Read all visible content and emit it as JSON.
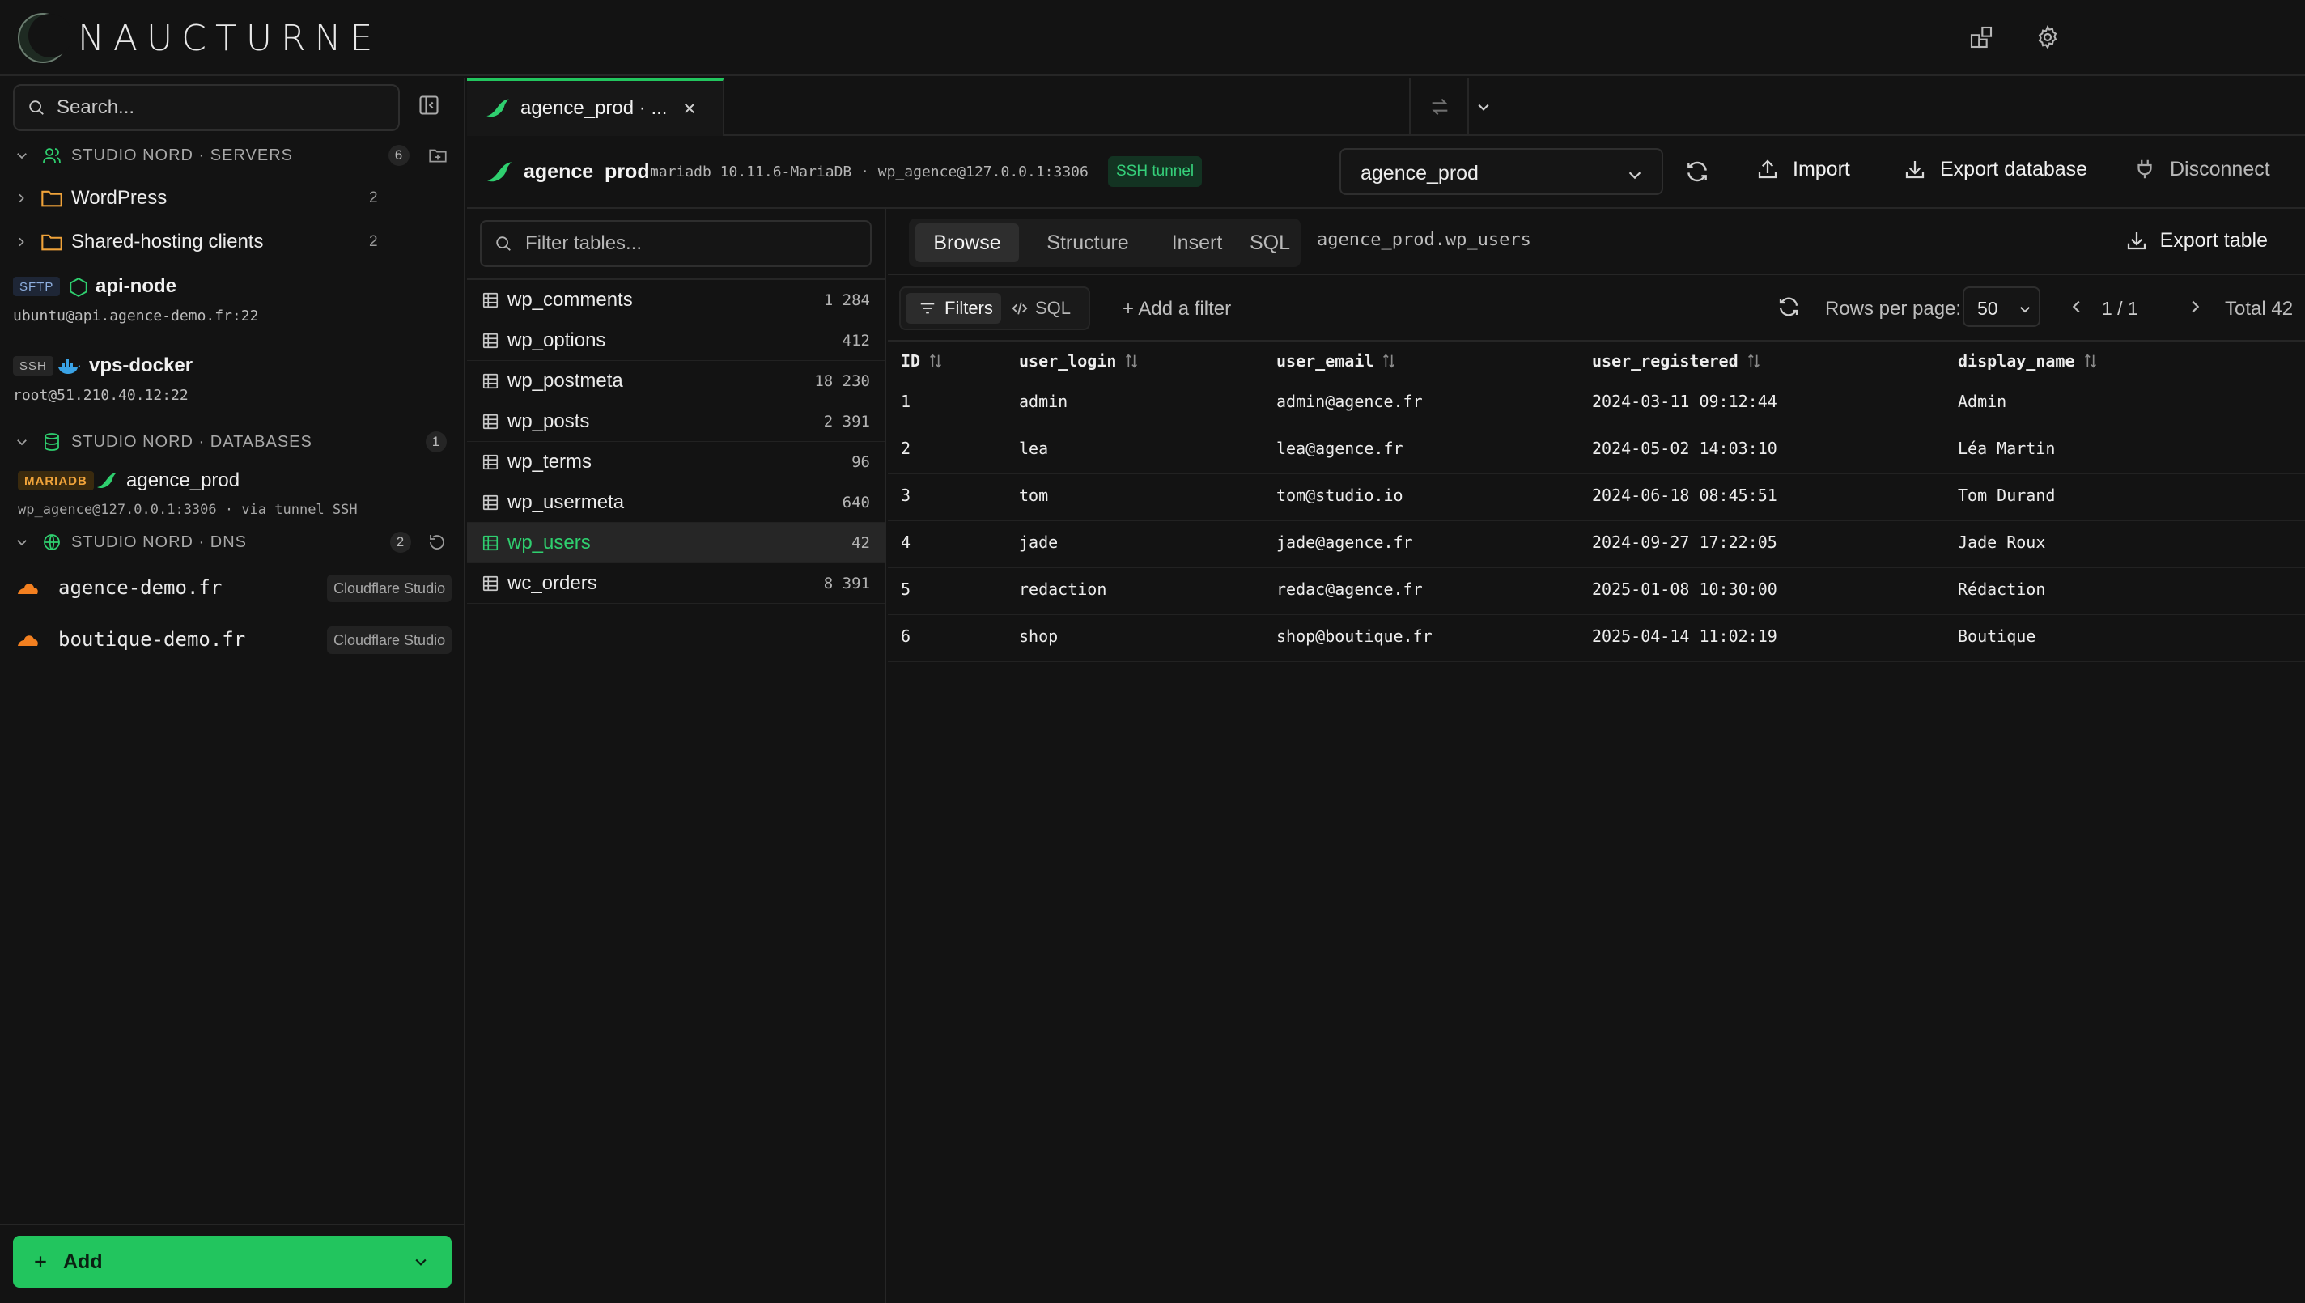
{
  "app": {
    "name": "NAUCTURNE"
  },
  "sidebar": {
    "search_placeholder": "Search...",
    "servers_group": {
      "label": "STUDIO NORD · SERVERS",
      "count": "6"
    },
    "folders": [
      {
        "label": "WordPress",
        "count": "2"
      },
      {
        "label": "Shared-hosting clients",
        "count": "2"
      }
    ],
    "connections": [
      {
        "type": "SFTP",
        "name": "api-node",
        "address": "ubuntu@api.agence-demo.fr:22"
      },
      {
        "type": "SSH",
        "name": "vps-docker",
        "address": "root@51.210.40.12:22"
      }
    ],
    "databases_group": {
      "label": "STUDIO NORD · DATABASES",
      "count": "1"
    },
    "database": {
      "engine": "MARIADB",
      "name": "agence_prod",
      "address": "wp_agence@127.0.0.1:3306 · via tunnel SSH"
    },
    "dns_group": {
      "label": "STUDIO NORD · DNS",
      "count": "2"
    },
    "dns": [
      {
        "domain": "agence-demo.fr",
        "provider": "Cloudflare Studio"
      },
      {
        "domain": "boutique-demo.fr",
        "provider": "Cloudflare Studio"
      }
    ],
    "add_label": "Add"
  },
  "tab": {
    "label": "agence_prod · ..."
  },
  "header": {
    "title": "agence_prod",
    "meta": "mariadb 10.11.6-MariaDB · wp_agence@127.0.0.1:3306",
    "tunnel": "SSH tunnel",
    "db_select": "agence_prod",
    "import": "Import",
    "export_db": "Export database",
    "disconnect": "Disconnect"
  },
  "tables": {
    "filter_placeholder": "Filter tables...",
    "items": [
      {
        "name": "wp_comments",
        "count": "1 284"
      },
      {
        "name": "wp_options",
        "count": "412"
      },
      {
        "name": "wp_postmeta",
        "count": "18 230"
      },
      {
        "name": "wp_posts",
        "count": "2 391"
      },
      {
        "name": "wp_terms",
        "count": "96"
      },
      {
        "name": "wp_usermeta",
        "count": "640"
      },
      {
        "name": "wp_users",
        "count": "42"
      },
      {
        "name": "wc_orders",
        "count": "8 391"
      }
    ],
    "active": "wp_users"
  },
  "main": {
    "tabs": [
      "Browse",
      "Structure",
      "Insert",
      "SQL"
    ],
    "active_tab": "Browse",
    "path": "agence_prod.wp_users",
    "export_table": "Export table",
    "filters": "Filters",
    "sql": "SQL",
    "add_filter": "+ Add a filter",
    "rows_per_page_label": "Rows per page:",
    "rows_per_page": "50",
    "page": "1 / 1",
    "total": "Total 42"
  },
  "grid": {
    "columns": [
      "ID",
      "user_login",
      "user_email",
      "user_registered",
      "display_name"
    ],
    "rows": [
      [
        "1",
        "admin",
        "admin@agence.fr",
        "2024-03-11 09:12:44",
        "Admin"
      ],
      [
        "2",
        "lea",
        "lea@agence.fr",
        "2024-05-02 14:03:10",
        "Léa Martin"
      ],
      [
        "3",
        "tom",
        "tom@studio.io",
        "2024-06-18 08:45:51",
        "Tom Durand"
      ],
      [
        "4",
        "jade",
        "jade@agence.fr",
        "2024-09-27 17:22:05",
        "Jade Roux"
      ],
      [
        "5",
        "redaction",
        "redac@agence.fr",
        "2025-01-08 10:30:00",
        "Rédaction"
      ],
      [
        "6",
        "shop",
        "shop@boutique.fr",
        "2025-04-14 11:02:19",
        "Boutique"
      ]
    ]
  },
  "colors": {
    "accent": "#22c55e",
    "background": "#131313",
    "maria_tag": "#f0a33a",
    "cloudflare": "#f38020"
  }
}
